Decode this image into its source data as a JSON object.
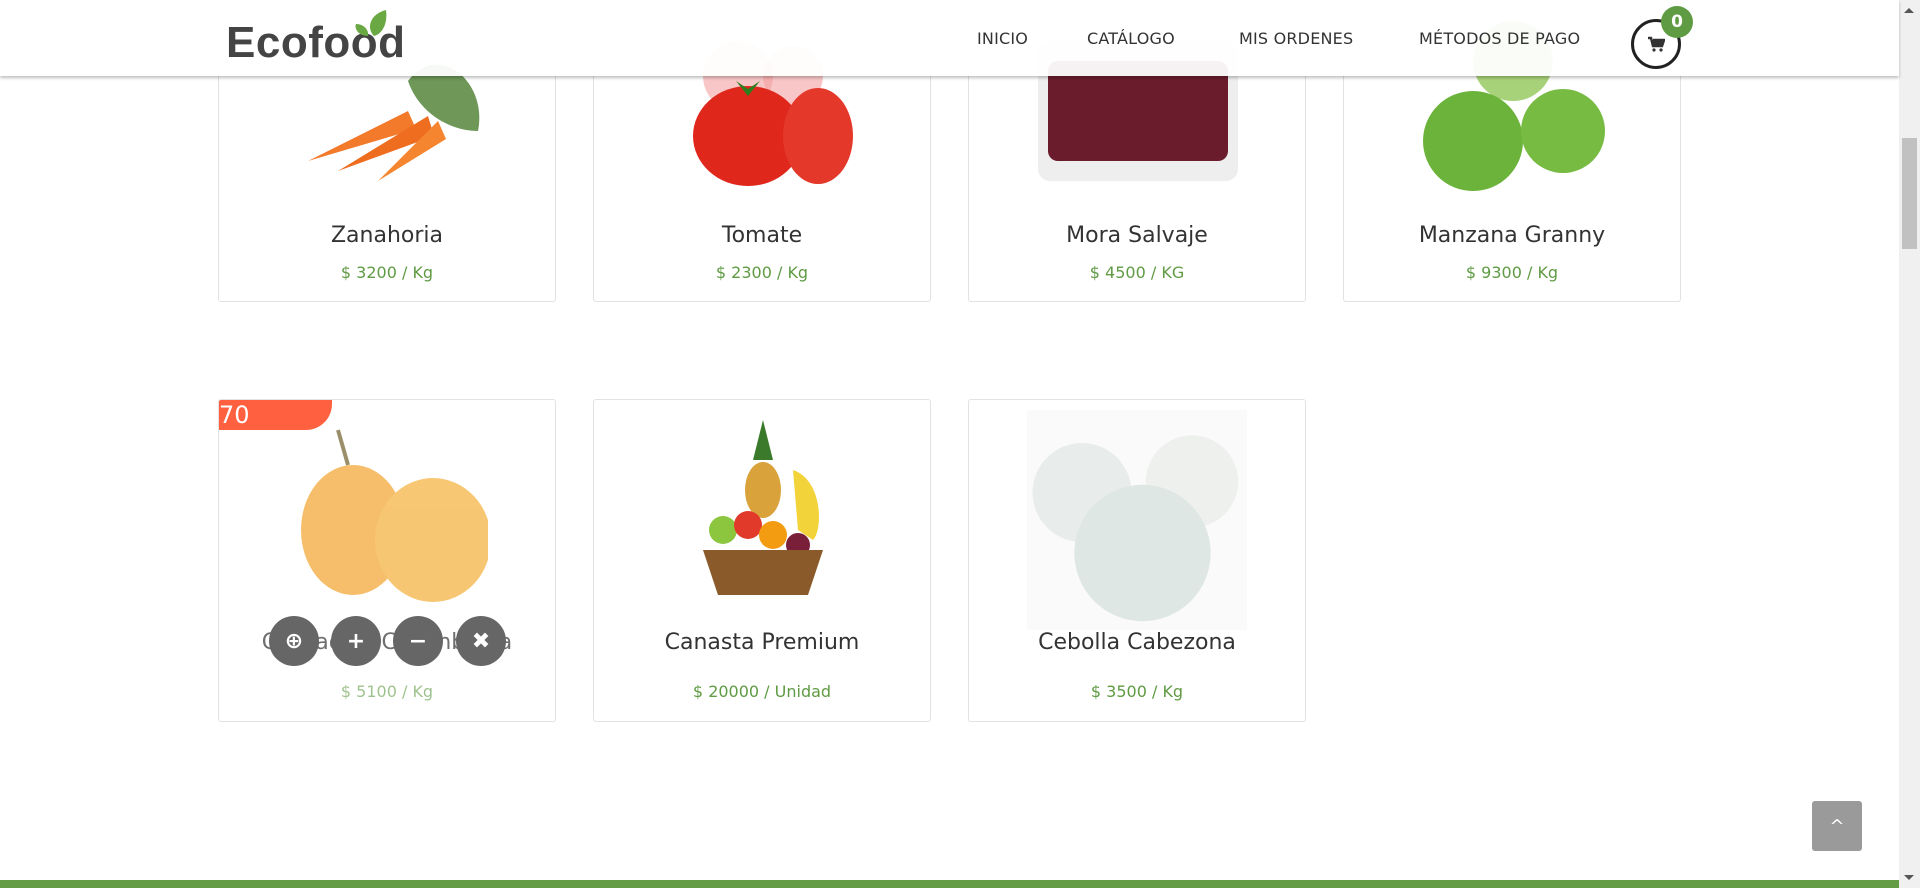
{
  "header": {
    "logo": "Ecofood",
    "nav": [
      "INICIO",
      "CATÁLOGO",
      "MIS ORDENES",
      "MÉTODOS DE PAGO"
    ],
    "cart_count": "0"
  },
  "products": [
    {
      "name": "Zanahoria",
      "price": "$ 3200 / Kg"
    },
    {
      "name": "Tomate",
      "price": "$ 2300 / Kg"
    },
    {
      "name": "Mora Salvaje",
      "price": "$ 4500 / KG"
    },
    {
      "name": "Manzana Granny",
      "price": "$ 9300 / Kg"
    },
    {
      "name": "Granadilla Colombiana",
      "price": "$ 5100 / Kg",
      "badge": "70"
    },
    {
      "name": "Canasta Premium",
      "price": "$ 20000 / Unidad"
    },
    {
      "name": "Cebolla Cabezona",
      "price": "$ 3500 / Kg"
    }
  ],
  "hover_actions": [
    "zoom-in-icon",
    "plus-icon",
    "minus-icon",
    "close-icon"
  ],
  "colors": {
    "accent": "#5f9b43",
    "sale": "#ff6140",
    "footer": "#649c46"
  }
}
